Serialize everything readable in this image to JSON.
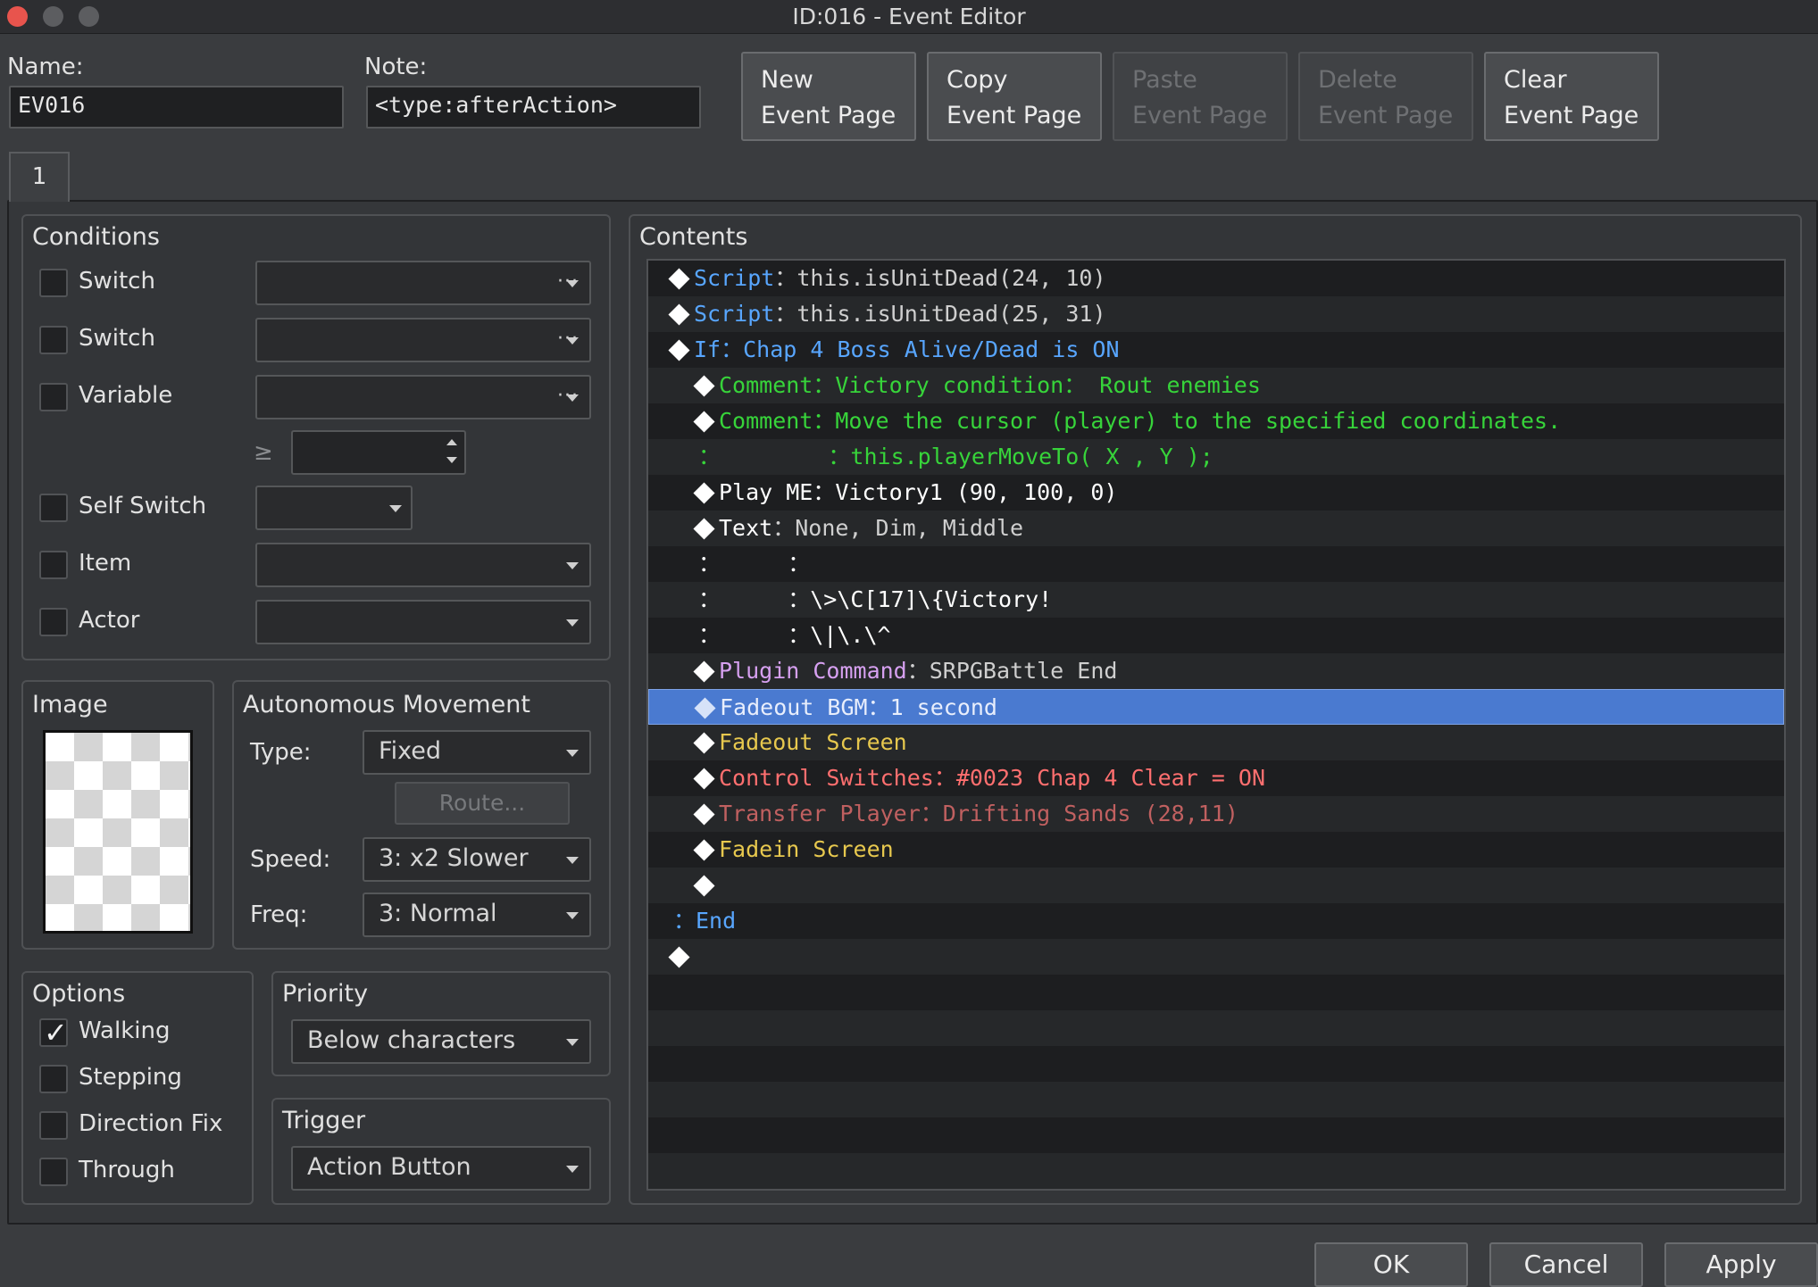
{
  "window": {
    "title": "ID:016 - Event Editor"
  },
  "name": {
    "label": "Name:",
    "value": "EV016"
  },
  "note": {
    "label": "Note:",
    "value": "<type:afterAction>"
  },
  "toolbar": [
    {
      "line1": "New",
      "line2": "Event Page",
      "enabled": true
    },
    {
      "line1": "Copy",
      "line2": "Event Page",
      "enabled": true
    },
    {
      "line1": "Paste",
      "line2": "Event Page",
      "enabled": false
    },
    {
      "line1": "Delete",
      "line2": "Event Page",
      "enabled": false
    },
    {
      "line1": "Clear",
      "line2": "Event Page",
      "enabled": true
    }
  ],
  "tabs": [
    {
      "label": "1"
    }
  ],
  "conditions": {
    "title": "Conditions",
    "switch1": "Switch",
    "switch2": "Switch",
    "variable": "Variable",
    "compare": "≥",
    "self_switch": "Self Switch",
    "item": "Item",
    "actor": "Actor",
    "more_glyph": "···"
  },
  "image": {
    "title": "Image"
  },
  "movement": {
    "title": "Autonomous Movement",
    "type_label": "Type:",
    "type_value": "Fixed",
    "route_label": "Route...",
    "speed_label": "Speed:",
    "speed_value": "3: x2 Slower",
    "freq_label": "Freq:",
    "freq_value": "3: Normal"
  },
  "options": {
    "title": "Options",
    "walking": "Walking",
    "walking_checked": true,
    "stepping": "Stepping",
    "direction_fix": "Direction Fix",
    "through": "Through"
  },
  "priority": {
    "title": "Priority",
    "value": "Below characters"
  },
  "trigger": {
    "title": "Trigger",
    "value": "Action Button"
  },
  "contents": {
    "title": "Contents",
    "rows": [
      {
        "indent": 0,
        "diamond": true,
        "parts": [
          {
            "t": "Script",
            "c": "c-blue"
          },
          {
            "t": "：this.isUnitDead(24, 10)",
            "c": "c-gray"
          }
        ]
      },
      {
        "indent": 0,
        "diamond": true,
        "parts": [
          {
            "t": "Script",
            "c": "c-blue"
          },
          {
            "t": "：this.isUnitDead(25, 31)",
            "c": "c-gray"
          }
        ]
      },
      {
        "indent": 0,
        "diamond": true,
        "parts": [
          {
            "t": "If：Chap 4 Boss Alive/Dead is ON",
            "c": "c-blue"
          }
        ]
      },
      {
        "indent": 1,
        "diamond": true,
        "parts": [
          {
            "t": "Comment：Victory condition： Rout enemies",
            "c": "c-green"
          }
        ]
      },
      {
        "indent": 1,
        "diamond": true,
        "parts": [
          {
            "t": "Comment：Move the cursor (player) to the specified coordinates.",
            "c": "c-green"
          }
        ]
      },
      {
        "indent": 1,
        "diamond": false,
        "parts": [
          {
            "t": "：        ：this.playerMoveTo( X , Y );",
            "c": "c-green"
          }
        ]
      },
      {
        "indent": 1,
        "diamond": true,
        "parts": [
          {
            "t": "Play ME：Victory1 (90, 100, 0)",
            "c": "c-white"
          }
        ]
      },
      {
        "indent": 1,
        "diamond": true,
        "parts": [
          {
            "t": "Text",
            "c": "c-white"
          },
          {
            "t": "：None, Dim, Middle",
            "c": "c-gray"
          }
        ]
      },
      {
        "indent": 1,
        "diamond": false,
        "parts": [
          {
            "t": "：     ：",
            "c": "c-white"
          }
        ]
      },
      {
        "indent": 1,
        "diamond": false,
        "parts": [
          {
            "t": "：     ：\\>\\C[17]\\{Victory!",
            "c": "c-white"
          }
        ]
      },
      {
        "indent": 1,
        "diamond": false,
        "parts": [
          {
            "t": "：     ：\\|\\.\\^",
            "c": "c-white"
          }
        ]
      },
      {
        "indent": 1,
        "diamond": true,
        "parts": [
          {
            "t": "Plugin Command",
            "c": "c-purple"
          },
          {
            "t": "：SRPGBattle End",
            "c": "c-gray"
          }
        ]
      },
      {
        "indent": 1,
        "diamond": true,
        "selected": true,
        "parts": [
          {
            "t": "Fadeout BGM：1 second",
            "c": "c-sel"
          }
        ]
      },
      {
        "indent": 1,
        "diamond": true,
        "parts": [
          {
            "t": "Fadeout Screen",
            "c": "c-yellow"
          }
        ]
      },
      {
        "indent": 1,
        "diamond": true,
        "parts": [
          {
            "t": "Control Switches：#0023 Chap 4 Clear = ON",
            "c": "c-red"
          }
        ]
      },
      {
        "indent": 1,
        "diamond": true,
        "parts": [
          {
            "t": "Transfer Player：Drifting Sands (28,11)",
            "c": "c-dimred"
          }
        ]
      },
      {
        "indent": 1,
        "diamond": true,
        "parts": [
          {
            "t": "Fadein Screen",
            "c": "c-yellow"
          }
        ]
      },
      {
        "indent": 1,
        "diamond": true,
        "parts": []
      },
      {
        "indent": 0,
        "diamond": false,
        "parts": [
          {
            "t": "：End",
            "c": "c-blue"
          }
        ]
      },
      {
        "indent": 0,
        "diamond": true,
        "parts": []
      }
    ]
  },
  "buttons": {
    "ok": "OK",
    "cancel": "Cancel",
    "apply": "Apply"
  }
}
